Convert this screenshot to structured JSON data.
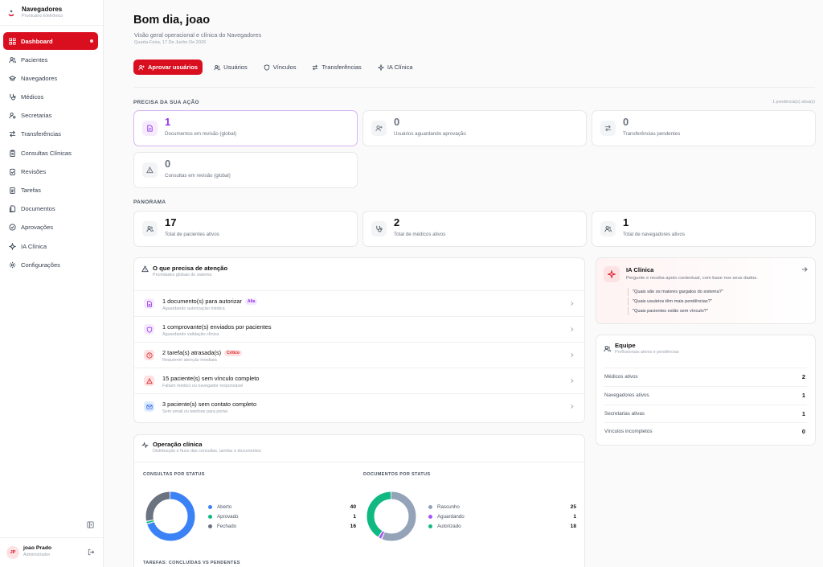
{
  "brand": {
    "title": "Navegadores",
    "subtitle": "Prontuário Eletrônico"
  },
  "sidebar": {
    "items": [
      {
        "label": "Dashboard",
        "icon": "dashboard-icon",
        "active": true
      },
      {
        "label": "Pacientes",
        "icon": "users-icon"
      },
      {
        "label": "Navegadores",
        "icon": "graduation-cap-icon"
      },
      {
        "label": "Médicos",
        "icon": "stethoscope-icon"
      },
      {
        "label": "Secretarias",
        "icon": "user-cog-icon"
      },
      {
        "label": "Transferências",
        "icon": "transfer-icon"
      },
      {
        "label": "Consultas Clínicas",
        "icon": "clipboard-icon"
      },
      {
        "label": "Revisões",
        "icon": "clipboard-check-icon"
      },
      {
        "label": "Tarefas",
        "icon": "clipboard-list-icon"
      },
      {
        "label": "Documentos",
        "icon": "documents-icon"
      },
      {
        "label": "Aprovações",
        "icon": "check-circle-icon"
      },
      {
        "label": "IA Clínica",
        "icon": "sparkle-icon"
      },
      {
        "label": "Configurações",
        "icon": "gear-icon"
      }
    ]
  },
  "user": {
    "initials": "JP",
    "name": "joao Prado",
    "role": "Administrador"
  },
  "header": {
    "greeting": "Bom dia, joao",
    "subtitle": "Visão geral operacional e clínica do Navegadores",
    "date": "Quarta-Feira, 17 De Junho De 2026"
  },
  "tabs": [
    {
      "label": "Aprovar usuários",
      "icon": "user-plus-icon",
      "primary": true
    },
    {
      "label": "Usuários",
      "icon": "users-icon"
    },
    {
      "label": "Vínculos",
      "icon": "shield-icon"
    },
    {
      "label": "Transferências",
      "icon": "transfer-icon"
    },
    {
      "label": "IA Clínica",
      "icon": "sparkle-icon"
    }
  ],
  "action": {
    "title": "PRECISA DA SUA AÇÃO",
    "pending": "1 pendência(s) ativa(s)",
    "cards": [
      {
        "value": "1",
        "label": "Documentos em revisão (global)",
        "icon": "file-icon"
      },
      {
        "value": "0",
        "label": "Usuários aguardando aprovação",
        "icon": "user-plus-icon"
      },
      {
        "value": "0",
        "label": "Transferências pendentes",
        "icon": "transfer-icon"
      },
      {
        "value": "0",
        "label": "Consultas em revisão (global)",
        "icon": "warning-icon"
      }
    ]
  },
  "panorama": {
    "title": "PANORAMA",
    "cards": [
      {
        "value": "17",
        "label": "Total de pacientes ativos",
        "icon": "users-icon"
      },
      {
        "value": "2",
        "label": "Total de médicos ativos",
        "icon": "stethoscope-icon"
      },
      {
        "value": "1",
        "label": "Total de navegadores ativos",
        "icon": "users-icon"
      }
    ]
  },
  "attention": {
    "title": "O que precisa de atenção",
    "subtitle": "Prioridades globais do sistema",
    "items": [
      {
        "title": "1 documento(s) para autorizar",
        "badge": "Alta",
        "subtitle": "Aguardando autorização médica",
        "icon": "file-icon",
        "color": "#9333ea",
        "bg": "#f5ebfd",
        "badge_bg": "#f3e8ff",
        "badge_color": "#9333ea"
      },
      {
        "title": "1 comprovante(s) enviados por pacientes",
        "badge": "",
        "subtitle": "Aguardando validação clínica",
        "icon": "shield-icon",
        "color": "#9333ea",
        "bg": "#f5ebfd"
      },
      {
        "title": "2 tarefa(s) atrasada(s)",
        "badge": "Crítico",
        "subtitle": "Requerem atenção imediata",
        "icon": "clock-icon",
        "color": "#dc2626",
        "bg": "#fde2e4",
        "badge_bg": "#fde2e4",
        "badge_color": "#dc2626"
      },
      {
        "title": "15 paciente(s) sem vínculo completo",
        "badge": "",
        "subtitle": "Faltam médico ou navegador responsável",
        "icon": "warning-icon",
        "color": "#dc2626",
        "bg": "#fde2e4"
      },
      {
        "title": "3 paciente(s) sem contato completo",
        "badge": "",
        "subtitle": "Sem email ou telefone para portal",
        "icon": "mail-icon",
        "color": "#2563eb",
        "bg": "#e0ecff"
      }
    ]
  },
  "operacao": {
    "title": "Operação clínica",
    "subtitle": "Distribuição e fluxo das consultas, tarefas e documentos",
    "tasks_title": "TAREFAS: CONCLUÍDAS VS PENDENTES"
  },
  "chart_data": [
    {
      "type": "pie",
      "title": "CONSULTAS POR STATUS",
      "donut": true,
      "categories": [
        "Aberto",
        "Aprovado",
        "Fechado"
      ],
      "values": [
        40,
        1,
        16
      ],
      "colors": [
        "#3b82f6",
        "#10b981",
        "#6b7280"
      ]
    },
    {
      "type": "pie",
      "title": "DOCUMENTOS POR STATUS",
      "donut": true,
      "categories": [
        "Rascunho",
        "Aguardando",
        "Autorizado"
      ],
      "values": [
        25,
        1,
        18
      ],
      "colors": [
        "#94a3b8",
        "#a855f7",
        "#10b981"
      ]
    }
  ],
  "ia": {
    "title": "IA Clínica",
    "subtitle": "Pergunte e receba apoio contextual, com base nos seus dados.",
    "questions": [
      "\"Quais são os maiores gargalos do sistema?\"",
      "\"Quais usuários têm mais pendências?\"",
      "\"Quais pacientes estão sem vínculo?\""
    ]
  },
  "equipe": {
    "title": "Equipe",
    "subtitle": "Profissionais ativos e pendências",
    "rows": [
      {
        "label": "Médicos ativos",
        "value": "2"
      },
      {
        "label": "Navegadores ativos",
        "value": "1"
      },
      {
        "label": "Secretarias ativas",
        "value": "1"
      },
      {
        "label": "Vínculos incompletos",
        "value": "0"
      }
    ]
  }
}
